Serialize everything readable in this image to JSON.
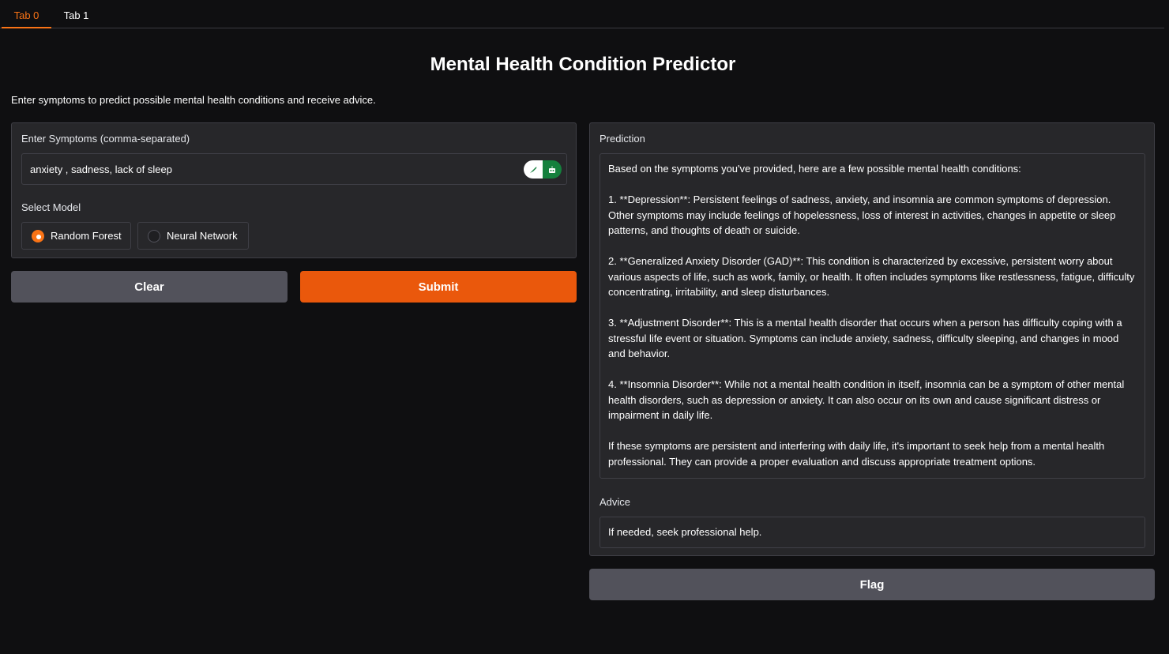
{
  "tabs": [
    "Tab 0",
    "Tab 1"
  ],
  "title": "Mental Health Condition Predictor",
  "description": "Enter symptoms to predict possible mental health conditions and receive advice.",
  "symptoms": {
    "label": "Enter Symptoms (comma-separated)",
    "value": "anxiety , sadness, lack of sleep"
  },
  "model": {
    "label": "Select Model",
    "options": [
      "Random Forest",
      "Neural Network"
    ],
    "selected": "Random Forest"
  },
  "buttons": {
    "clear": "Clear",
    "submit": "Submit",
    "flag": "Flag"
  },
  "prediction": {
    "label": "Prediction",
    "paragraphs": [
      "Based on the symptoms you've provided, here are a few possible mental health conditions:",
      "1. **Depression**: Persistent feelings of sadness, anxiety, and insomnia are common symptoms of depression. Other symptoms may include feelings of hopelessness, loss of interest in activities, changes in appetite or sleep patterns, and thoughts of death or suicide.",
      "2. **Generalized Anxiety Disorder (GAD)**: This condition is characterized by excessive, persistent worry about various aspects of life, such as work, family, or health. It often includes symptoms like restlessness, fatigue, difficulty concentrating, irritability, and sleep disturbances.",
      "3. **Adjustment Disorder**: This is a mental health disorder that occurs when a person has difficulty coping with a stressful life event or situation. Symptoms can include anxiety, sadness, difficulty sleeping, and changes in mood and behavior.",
      "4. **Insomnia Disorder**: While not a mental health condition in itself, insomnia can be a symptom of other mental health disorders, such as depression or anxiety. It can also occur on its own and cause significant distress or impairment in daily life.",
      "If these symptoms are persistent and interfering with daily life, it's important to seek help from a mental health professional. They can provide a proper evaluation and discuss appropriate treatment options."
    ]
  },
  "advice": {
    "label": "Advice",
    "value": "If needed, seek professional help."
  },
  "icons": [
    "feather-icon",
    "robot-icon"
  ],
  "colors": {
    "accent": "#f97316",
    "submit": "#ea580c",
    "secondary": "#52525b",
    "extension": "#15803d"
  }
}
